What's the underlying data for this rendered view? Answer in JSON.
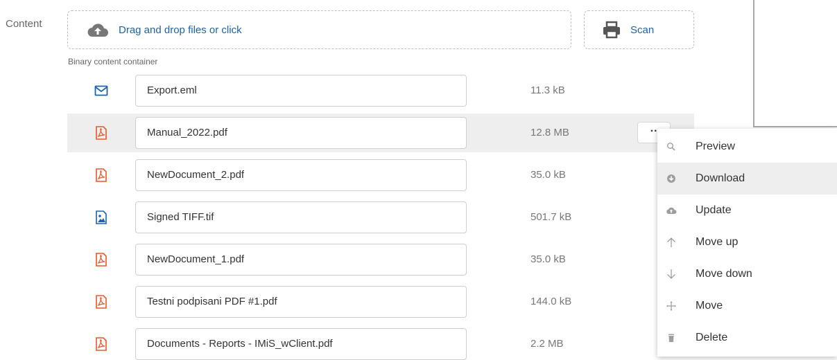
{
  "content_label": "Content",
  "dropzone": {
    "label": "Drag and drop files or click",
    "icon": "cloud-upload-icon"
  },
  "scan": {
    "label": "Scan",
    "icon": "printer-icon"
  },
  "container_label": "Binary content container",
  "files": [
    {
      "name": "Export.eml",
      "size": "11.3 kB",
      "icon": "envelope-icon"
    },
    {
      "name": "Manual_2022.pdf",
      "size": "12.8 MB",
      "icon": "pdf-icon",
      "highlighted": true
    },
    {
      "name": "NewDocument_2.pdf",
      "size": "35.0 kB",
      "icon": "pdf-icon"
    },
    {
      "name": "Signed TIFF.tif",
      "size": "501.7 kB",
      "icon": "image-file-icon"
    },
    {
      "name": "NewDocument_1.pdf",
      "size": "35.0 kB",
      "icon": "pdf-icon"
    },
    {
      "name": "Testni podpisani PDF #1.pdf",
      "size": "144.0 kB",
      "icon": "pdf-icon"
    },
    {
      "name": "Documents - Reports - IMiS_wClient.pdf",
      "size": "2.2 MB",
      "icon": "pdf-icon"
    }
  ],
  "more_button": {
    "label": "··",
    "icon": "more-icon"
  },
  "context_menu": {
    "items": [
      {
        "label": "Preview",
        "icon": "search-icon"
      },
      {
        "label": "Download",
        "icon": "download-icon",
        "active": true
      },
      {
        "label": "Update",
        "icon": "cloud-upload-icon"
      },
      {
        "label": "Move up",
        "icon": "arrow-up-icon"
      },
      {
        "label": "Move down",
        "icon": "arrow-down-icon"
      },
      {
        "label": "Move",
        "icon": "move-icon"
      },
      {
        "label": "Delete",
        "icon": "trash-icon"
      }
    ]
  },
  "colors": {
    "accent": "#1b63a6",
    "pdf": "#e8572a",
    "highlight": "#eeeeee",
    "menu_icon": "#9e9e9e"
  }
}
